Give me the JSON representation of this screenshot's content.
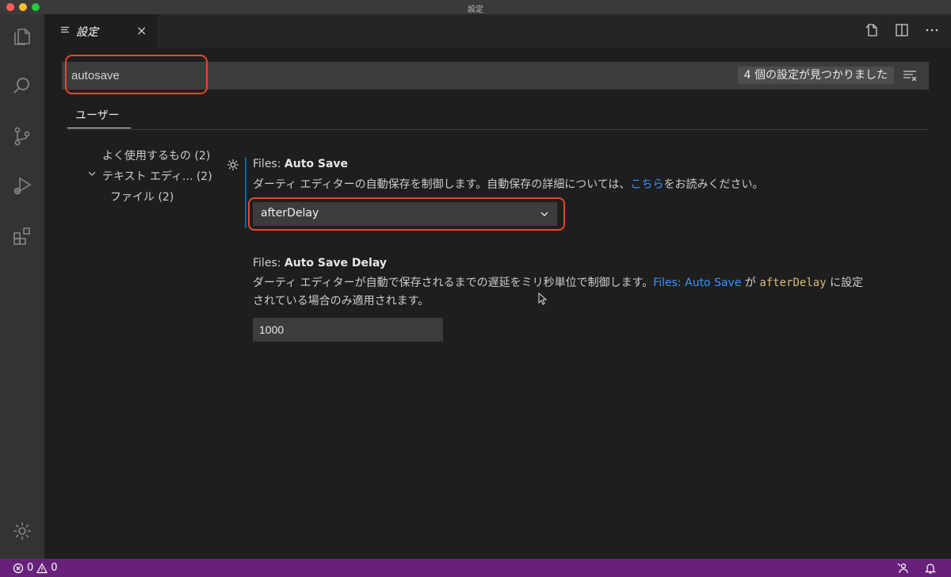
{
  "window": {
    "title": "設定"
  },
  "tab": {
    "label": "設定",
    "close": "×"
  },
  "search": {
    "value": "autosave",
    "result_count": "4 個の設定が見つかりました"
  },
  "scope": {
    "label": "ユーザー"
  },
  "toc": {
    "items": [
      {
        "label": "よく使用するもの (2)"
      },
      {
        "label": "テキスト エディ...  (2)"
      },
      {
        "label": "ファイル (2)"
      }
    ]
  },
  "settings": {
    "auto_save": {
      "category": "Files: ",
      "name": "Auto Save",
      "desc_before": "ダーティ エディターの自動保存を制御します。自動保存の詳細については、",
      "desc_link": "こちら",
      "desc_after": "をお読みください。",
      "value": "afterDelay"
    },
    "auto_save_delay": {
      "category": "Files: ",
      "name": "Auto Save Delay",
      "desc_line1": "ダーティ エディターが自動で保存されるまでの遅延をミリ秒単位で制御します。",
      "desc_link": "Files: Auto Save",
      "desc_mid": " が ",
      "desc_code": "afterDelay",
      "desc_end": " に設定",
      "desc_line2": "されている場合のみ適用されます。",
      "value": "1000"
    }
  },
  "status": {
    "errors": "0",
    "warnings": "0"
  },
  "colors": {
    "accent": "#0e639c",
    "statusbar": "#68217a",
    "highlight": "#e8472c",
    "link": "#3794ff"
  },
  "icons": [
    "explorer-icon",
    "search-icon",
    "source-control-icon",
    "run-debug-icon",
    "extensions-icon",
    "manage-gear-icon",
    "open-json-icon",
    "split-editor-icon",
    "more-actions-icon",
    "clear-filter-icon",
    "error-icon",
    "warning-icon",
    "feedback-icon",
    "notifications-bell-icon"
  ]
}
